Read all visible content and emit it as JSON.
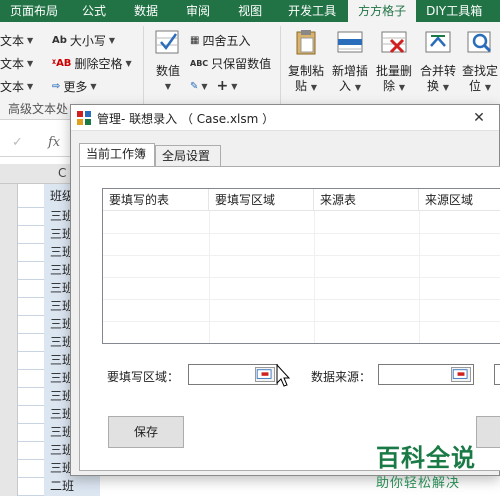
{
  "ribbon_tabs": [
    {
      "label": "页面布局"
    },
    {
      "label": "公式"
    },
    {
      "label": "数据"
    },
    {
      "label": "审阅"
    },
    {
      "label": "视图"
    },
    {
      "label": "开发工具"
    },
    {
      "label": "方方格子"
    },
    {
      "label": "DIY工具箱"
    }
  ],
  "ribbon": {
    "text_group": {
      "items": [
        "文本",
        "文本",
        "文本"
      ],
      "label": "高级文本处"
    },
    "case_group": {
      "upper_lower": "大小写",
      "remove_space": "删除空格",
      "more": "更多"
    },
    "number_group": {
      "value_label": "数值",
      "round": "四舍五入",
      "keep_value": "只保留数值"
    },
    "big_buttons": [
      {
        "line1": "复制粘",
        "line2": "贴"
      },
      {
        "line1": "新增插",
        "line2": "入"
      },
      {
        "line1": "批量删",
        "line2": "除"
      },
      {
        "line1": "合并转",
        "line2": "换"
      },
      {
        "line1": "查找定",
        "line2": "位"
      }
    ]
  },
  "formula_bar": {
    "cancel": "✓",
    "fx": "fx"
  },
  "sheet": {
    "column_letter": "C",
    "header_cell": "班级",
    "cell_value": "三班",
    "last_cell": "二班"
  },
  "dialog": {
    "title": "管理- 联想录入 （ Case.xlsm ）",
    "close": "✕",
    "tabs": [
      {
        "label": "当前工作簿"
      },
      {
        "label": "全局设置"
      }
    ],
    "grid_headers": [
      "要填写的表",
      "要填写区域",
      "来源表",
      "来源区域"
    ],
    "fill_area_label": "要填写区域：",
    "source_label": "数据来源：",
    "save_button": "保存"
  },
  "watermark": {
    "title": "百科全说",
    "subtitle": "助你轻松解决"
  },
  "colors": {
    "excel_green": "#217346",
    "selection_blue": "#dce6f1",
    "watermark_green": "#1a7a45"
  }
}
